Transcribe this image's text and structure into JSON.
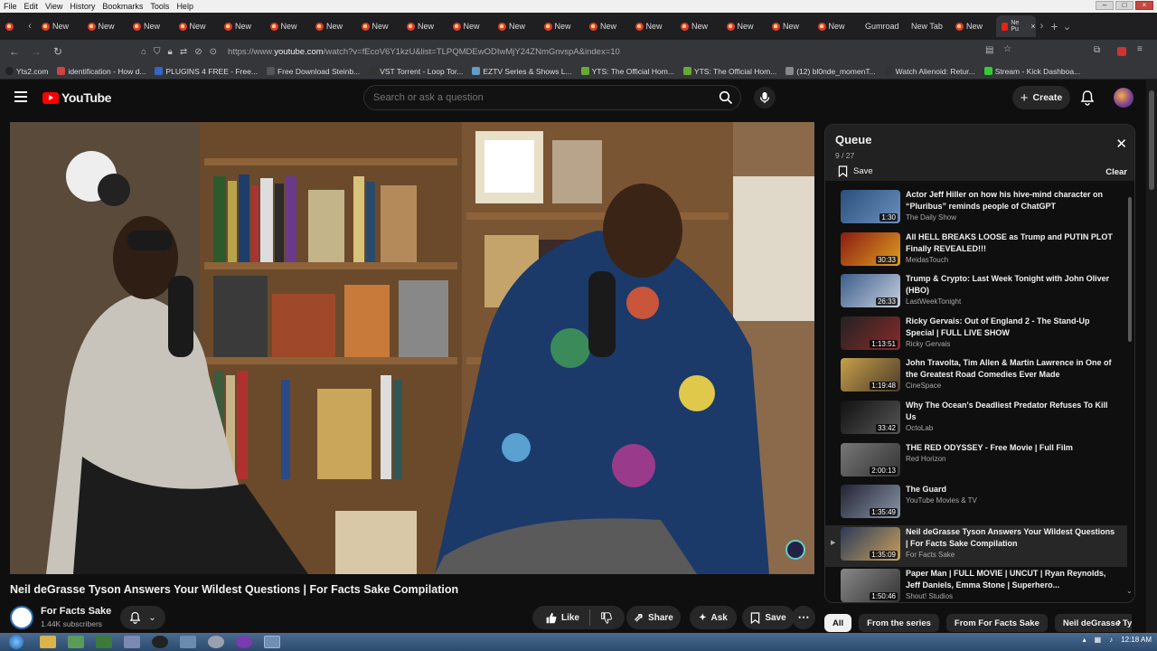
{
  "menubar": {
    "items": [
      "File",
      "Edit",
      "View",
      "History",
      "Bookmarks",
      "Tools",
      "Help"
    ]
  },
  "tabs": {
    "new_label": "New",
    "gumroad": "Gumroad",
    "new_tab": "New Tab",
    "active_label": "Ne Pu"
  },
  "toolbar": {
    "url_prefix": "https://www.",
    "url_domain": "youtube.com",
    "url_rest": "/watch?v=fEcoV6Y1kzU&list=TLPQMDEwODIwMjY24ZNmGnvspA&index=10"
  },
  "bookmarks": [
    {
      "label": "Yts2.com",
      "color": "#222"
    },
    {
      "label": "identification - How d...",
      "color": "#c44"
    },
    {
      "label": "PLUGINS 4 FREE - Free...",
      "color": "#36c"
    },
    {
      "label": "Free Download Steinb...",
      "color": "#555"
    },
    {
      "label": "VST Torrent - Loop Tor...",
      "color": "#333"
    },
    {
      "label": "EZTV Series & Shows L...",
      "color": "#69c"
    },
    {
      "label": "YTS: The Official Hom...",
      "color": "#6a3"
    },
    {
      "label": "YTS: The Official Hom...",
      "color": "#6a3"
    },
    {
      "label": "(12) bl0nde_momenT...",
      "color": "#888"
    },
    {
      "label": "Watch Alienoid: Retur...",
      "color": "#333"
    },
    {
      "label": "Stream - Kick Dashboa...",
      "color": "#3c3"
    }
  ],
  "youtube": {
    "logo": "YouTube",
    "search_placeholder": "Search or ask a question",
    "create_label": "Create"
  },
  "video": {
    "title": "Neil deGrasse Tyson Answers Your Wildest Questions | For Facts Sake Compilation",
    "channel": "For Facts Sake",
    "subscribers": "1.44K subscribers",
    "like_label": "Like",
    "share_label": "Share",
    "ask_label": "Ask",
    "save_label": "Save"
  },
  "queue": {
    "title": "Queue",
    "count": "9 / 27",
    "save_label": "Save",
    "clear_label": "Clear",
    "items": [
      {
        "title": "Actor Jeff Hiller on how his hive-mind character on “Pluribus” reminds people of ChatGPT",
        "channel": "The Daily Show",
        "duration": "1:30",
        "thumb": "#2a4f7a"
      },
      {
        "title": "All HELL BREAKS LOOSE as Trump and PUTIN PLOT Finally REVEALED!!!",
        "channel": "MeidasTouch",
        "duration": "30:33",
        "thumb": "#8a1a12"
      },
      {
        "title": "Trump & Crypto: Last Week Tonight with John Oliver (HBO)",
        "channel": "LastWeekTonight",
        "duration": "26:33",
        "thumb": "#3b5d8a"
      },
      {
        "title": "Ricky Gervais: Out of England 2 - The Stand-Up Special | FULL LIVE SHOW",
        "channel": "Ricky Gervais",
        "duration": "1:13:51",
        "thumb": "#5a1a1a"
      },
      {
        "title": "John Travolta, Tim Allen & Martin Lawrence in One of the Greatest Road Comedies Ever Made",
        "channel": "CineSpace",
        "duration": "1:19:48",
        "thumb": "#9a7a3a"
      },
      {
        "title": "Why The Ocean's Deadliest Predator Refuses To Kill Us",
        "channel": "OctoLab",
        "duration": "33:42",
        "thumb": "#1a1a1a"
      },
      {
        "title": "THE RED ODYSSEY - Free Movie | Full Film",
        "channel": "Red Horizon",
        "duration": "2:00:13",
        "thumb": "#5a5a5a"
      },
      {
        "title": "The Guard",
        "channel": "YouTube Movies & TV",
        "duration": "1:35:49",
        "thumb": "#3a4a5a"
      },
      {
        "title": "Neil deGrasse Tyson Answers Your Wildest Questions | For Facts Sake Compilation",
        "channel": "For Facts Sake",
        "duration": "1:35:09",
        "thumb": "#2a3a5a",
        "current": true
      },
      {
        "title": "Paper Man | FULL MOVIE | UNCUT | Ryan Reynolds, Jeff Daniels, Emma Stone | Superhero...",
        "channel": "Shout! Studios",
        "duration": "1:50:46",
        "thumb": "#6a6a6a"
      }
    ]
  },
  "chips": [
    "All",
    "From the series",
    "From For Facts Sake",
    "Neil deGrasse Tys"
  ],
  "taskbar": {
    "time": "12:18 AM"
  }
}
